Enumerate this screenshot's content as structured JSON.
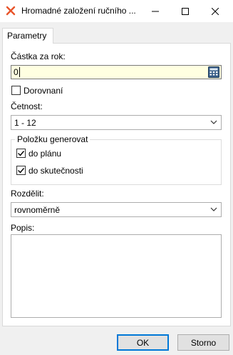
{
  "window": {
    "title": "Hromadné založení ručního ...",
    "brand_color": "#e8542a"
  },
  "tabs": [
    {
      "label": "Parametry",
      "active": true
    }
  ],
  "form": {
    "amount_label": "Částka za rok:",
    "amount_value": "0",
    "rounding_label": "Dorovnaní",
    "rounding_checked": false,
    "frequency_label": "Četnost:",
    "frequency_value": "1 - 12",
    "generate_group_title": "Položku generovat",
    "generate_plan_label": "do plánu",
    "generate_plan_checked": true,
    "generate_actual_label": "do skutečnosti",
    "generate_actual_checked": true,
    "split_label": "Rozdělit:",
    "split_value": "rovnoměrně",
    "notes_label": "Popis:",
    "notes_value": ""
  },
  "buttons": {
    "ok": "OK",
    "cancel": "Storno"
  }
}
